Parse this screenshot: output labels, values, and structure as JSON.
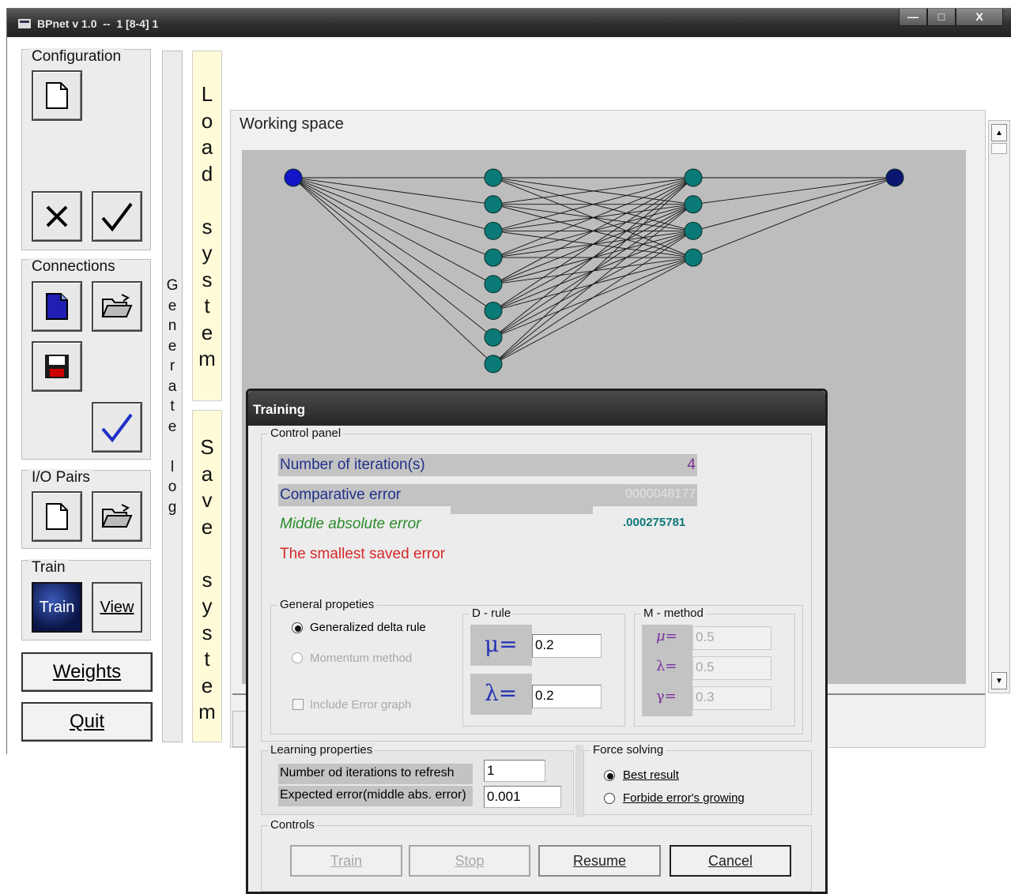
{
  "window": {
    "title": "BPnet v 1.0  --  1 [8-4] 1",
    "controls": [
      "minimize",
      "maximize",
      "close"
    ],
    "close_glyph": "X"
  },
  "sidebar": {
    "configuration_label": "Configuration",
    "connections_label": "Connections",
    "io_pairs_label": "I/O Pairs",
    "train_group_label": "Train",
    "train_button": "Train",
    "view_button": "View",
    "weights_button": "Weights",
    "quit_button": "Quit"
  },
  "strips": {
    "load_system": [
      "L",
      "o",
      "a",
      "d",
      "",
      "s",
      "y",
      "s",
      "t",
      "e",
      "m"
    ],
    "save_system": [
      "S",
      "a",
      "v",
      "e",
      "",
      "s",
      "y",
      "s",
      "t",
      "e",
      "m"
    ],
    "generate_log": [
      "G",
      "e",
      "n",
      "e",
      "r",
      "a",
      "t",
      "e",
      "",
      "l",
      "o",
      "g"
    ]
  },
  "workspace": {
    "title": "Working space",
    "network": {
      "layers": [
        1,
        8,
        4,
        1
      ]
    }
  },
  "training": {
    "title": "Training",
    "control_panel": {
      "title": "Control panel",
      "iterations_label": "Number of iteration(s)",
      "iterations_value": "4",
      "comparative_label": "Comparative error",
      "comparative_value": "0000048177",
      "middle_label": "Middle absolute error",
      "middle_value": ".000275781",
      "smallest_label": "The smallest saved error"
    },
    "general": {
      "title": "General propeties",
      "generalized_label": "Generalized delta rule",
      "momentum_label": "Momentum method",
      "error_graph_label": "Include Error graph"
    },
    "d_rule": {
      "title": "D - rule",
      "mu_label": "μ=",
      "mu_value": "0.2",
      "lambda_label": "λ=",
      "lambda_value": "0.2"
    },
    "m_method": {
      "title": "M - method",
      "mu_label": "μ=",
      "mu_value": "0.5",
      "lambda_label": "λ=",
      "lambda_value": "0.5",
      "gamma_label": "γ=",
      "gamma_value": "0.3"
    },
    "learning": {
      "title": "Learning properties",
      "refresh_label": "Number od iterations to refresh",
      "refresh_value": "1",
      "expected_label": "Expected error(middle abs. error)",
      "expected_value": "0.001"
    },
    "force": {
      "title": "Force solving",
      "best_label": "Best result",
      "forbide_label": "Forbide error's growing"
    },
    "controls": {
      "title": "Controls",
      "train": "Train",
      "stop": "Stop",
      "resume": "Resume",
      "cancel": "Cancel"
    }
  },
  "colors": {
    "input_node": "#1414c8",
    "hidden_node": "#0b7a76",
    "output_node": "#0a1670",
    "iter_text": "#7a2f8f",
    "comp_text": "#22308a",
    "middle_text": "#2a8a2a",
    "smallest_text": "#d42a2a"
  }
}
